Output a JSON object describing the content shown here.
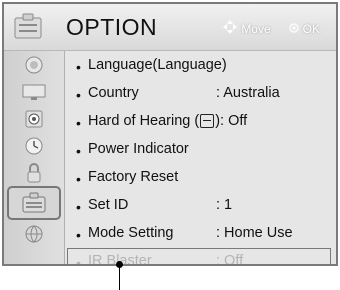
{
  "header": {
    "title": "OPTION",
    "move_label": "Move",
    "ok_label": "OK"
  },
  "sidebar": {
    "items": [
      {
        "name": "picture-icon"
      },
      {
        "name": "screen-icon"
      },
      {
        "name": "audio-icon"
      },
      {
        "name": "time-icon"
      },
      {
        "name": "lock-icon"
      },
      {
        "name": "option-icon",
        "active": true
      },
      {
        "name": "network-icon"
      }
    ]
  },
  "menu": {
    "language": {
      "label": "Language(Language)"
    },
    "country": {
      "label": "Country",
      "value": ": Australia"
    },
    "hard_of_hearing": {
      "label_prefix": "Hard of Hearing (",
      "label_suffix": "): Off"
    },
    "power_indicator": {
      "label": "Power Indicator"
    },
    "factory_reset": {
      "label": "Factory Reset"
    },
    "set_id": {
      "label": "Set ID",
      "value": ": 1"
    },
    "mode_setting": {
      "label": "Mode Setting",
      "value": ": Home Use"
    },
    "ir_blaster": {
      "label": "IR Blaster",
      "value": ": Off",
      "disabled": true
    }
  },
  "colors": {
    "frame": "#7a7a7a",
    "background": "#e6e6e6",
    "disabled_text": "#b4b4b4"
  }
}
